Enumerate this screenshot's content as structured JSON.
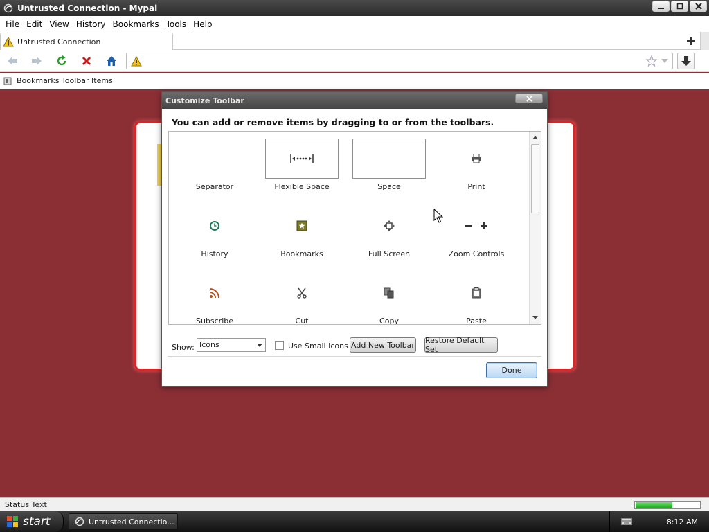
{
  "window": {
    "title": "Untrusted Connection - Mypal"
  },
  "menu": [
    {
      "label": "File",
      "key": "F",
      "rest": "ile"
    },
    {
      "label": "Edit",
      "key": "E",
      "rest": "dit"
    },
    {
      "label": "View",
      "key": "V",
      "rest": "iew"
    },
    {
      "label": "History",
      "key": "",
      "rest": "History"
    },
    {
      "label": "Bookmarks",
      "key": "B",
      "rest": "ookmarks"
    },
    {
      "label": "Tools",
      "key": "T",
      "rest": "ools"
    },
    {
      "label": "Help",
      "key": "H",
      "rest": "elp"
    }
  ],
  "tab": {
    "label": "Untrusted Connection"
  },
  "bookmarks_bar": {
    "label": "Bookmarks Toolbar Items"
  },
  "dialog": {
    "title": "Customize Toolbar",
    "heading": "You can add or remove items by dragging to or from the toolbars.",
    "items": [
      {
        "label": "Separator",
        "icon": "separator-icon"
      },
      {
        "label": "Flexible Space",
        "icon": "flexible-space-icon"
      },
      {
        "label": "Space",
        "icon": "space-icon"
      },
      {
        "label": "Print",
        "icon": "print-icon"
      },
      {
        "label": "History",
        "icon": "history-icon"
      },
      {
        "label": "Bookmarks",
        "icon": "bookmarks-icon"
      },
      {
        "label": "Full Screen",
        "icon": "fullscreen-icon"
      },
      {
        "label": "Zoom Controls",
        "icon": "zoom-controls-icon"
      },
      {
        "label": "Subscribe",
        "icon": "rss-icon"
      },
      {
        "label": "Cut",
        "icon": "cut-icon"
      },
      {
        "label": "Copy",
        "icon": "copy-icon"
      },
      {
        "label": "Paste",
        "icon": "paste-icon"
      }
    ],
    "show_label": "Show:",
    "show_value": "Icons",
    "small_icons_label": "Use Small Icons",
    "add_toolbar_label": "Add New Toolbar",
    "restore_label": "Restore Default Set",
    "done_label": "Done"
  },
  "status": {
    "text": "Status Text",
    "progress": 0.58
  },
  "taskbar": {
    "start": "start",
    "task": "Untrusted Connectio...",
    "clock": "8:12 AM"
  },
  "colors": {
    "content_bg": "#8b2f35",
    "error_border": "#d62828",
    "accent": "#3b6ea8"
  }
}
